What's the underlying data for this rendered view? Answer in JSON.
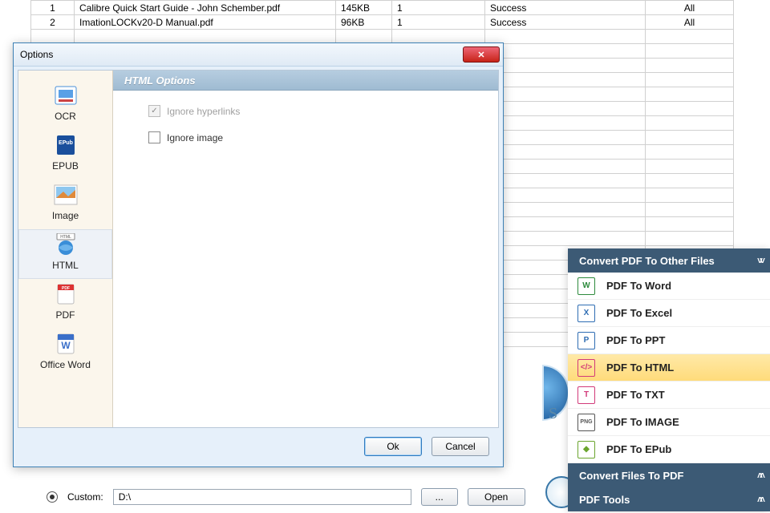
{
  "table": {
    "rows": [
      {
        "idx": "1",
        "name": "Calibre Quick Start Guide - John Schember.pdf",
        "size": "145KB",
        "n": "1",
        "status": "Success",
        "scope": "All"
      },
      {
        "idx": "2",
        "name": "ImationLOCKv20-D Manual.pdf",
        "size": "96KB",
        "n": "1",
        "status": "Success",
        "scope": "All"
      }
    ]
  },
  "dialog": {
    "title": "Options",
    "pane_title": "HTML Options",
    "sidebar": [
      {
        "label": "OCR"
      },
      {
        "label": "EPUB"
      },
      {
        "label": "Image"
      },
      {
        "label": "HTML"
      },
      {
        "label": "PDF"
      },
      {
        "label": "Office Word"
      }
    ],
    "checks": {
      "ignore_hyperlinks": "Ignore hyperlinks",
      "ignore_image": "Ignore image"
    },
    "ok": "Ok",
    "cancel": "Cancel"
  },
  "custom": {
    "label": "Custom:",
    "path": "D:\\",
    "browse": "...",
    "open": "Open"
  },
  "panel": {
    "header1": "Convert PDF To Other Files",
    "items": [
      {
        "label": "PDF To Word"
      },
      {
        "label": "PDF To Excel"
      },
      {
        "label": "PDF To PPT"
      },
      {
        "label": "PDF To HTML"
      },
      {
        "label": "PDF To TXT"
      },
      {
        "label": "PDF To IMAGE"
      },
      {
        "label": "PDF To EPub"
      }
    ],
    "header2": "Convert Files To PDF",
    "header3": "PDF Tools"
  }
}
